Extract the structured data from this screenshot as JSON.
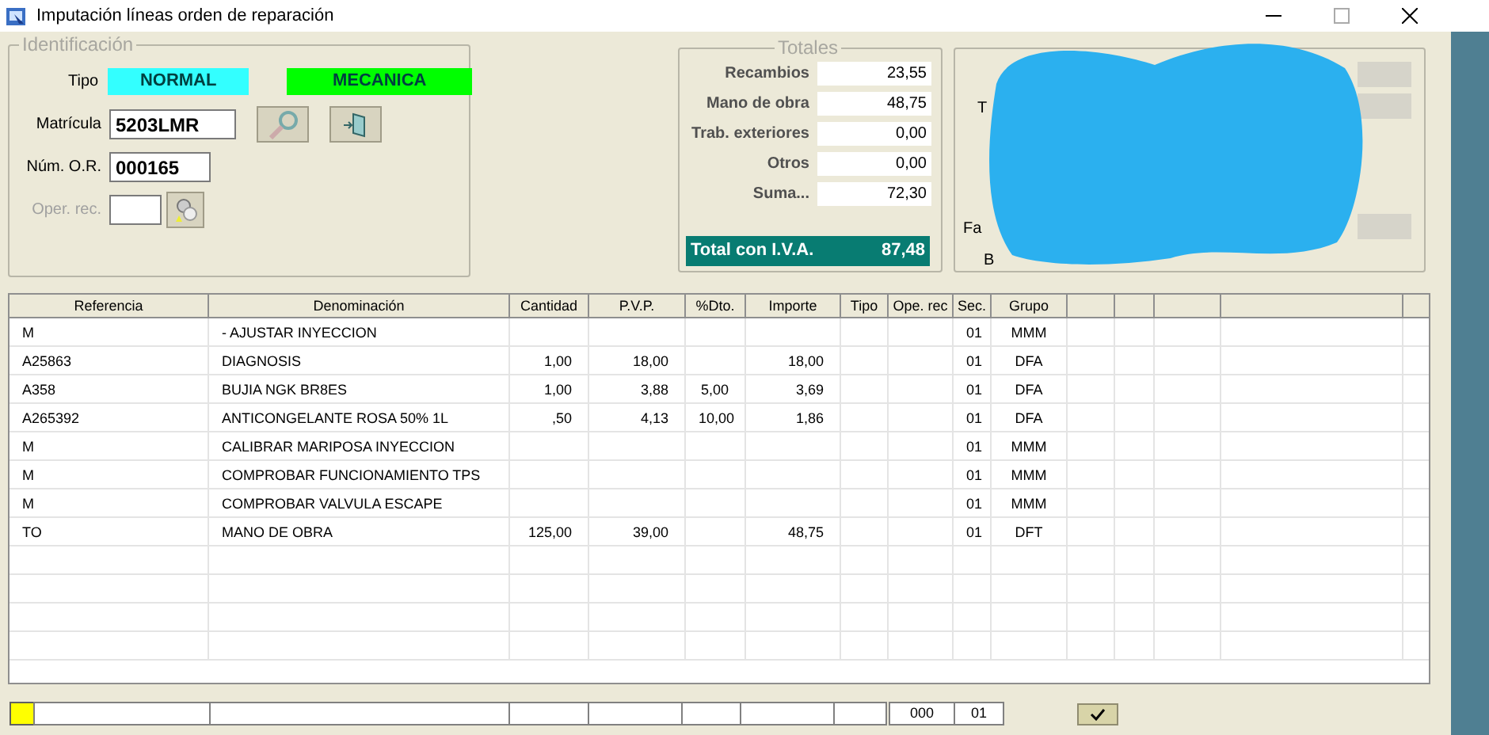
{
  "window": {
    "title": "Imputación líneas orden de reparación"
  },
  "identificacion": {
    "legend": "Identificación",
    "tipo_label": "Tipo",
    "tipo_badges": [
      {
        "text": "NORMAL",
        "color": "#33ffff"
      },
      {
        "text": "MECANICA",
        "color": "#00ff00"
      }
    ],
    "fields": [
      {
        "label": "Matrícula",
        "value": "5203LMR",
        "disabled": false
      },
      {
        "label": "Núm. O.R.",
        "value": "000165",
        "disabled": false
      },
      {
        "label": "Oper. rec.",
        "disabled": true
      }
    ]
  },
  "totales": {
    "legend": "Totales",
    "rows": [
      {
        "label": "Recambios",
        "value": "23,55"
      },
      {
        "label": "Mano de obra",
        "value": "48,75"
      },
      {
        "label": "Trab. exteriores",
        "value": "0,00"
      },
      {
        "label": "Otros",
        "value": "0,00"
      },
      {
        "label": "Suma...",
        "value": "72,30"
      }
    ],
    "total": {
      "label": "Total con I.V.A.",
      "value": "87,48"
    }
  },
  "cliente": {
    "labels": [
      "T",
      "Fa",
      "B"
    ]
  },
  "table": {
    "columns": [
      "Referencia",
      "Denominación",
      "Cantidad",
      "P.V.P.",
      "%Dto.",
      "Importe",
      "Tipo",
      "Ope. rec",
      "Sec.",
      "Grupo"
    ],
    "rows": [
      [
        "M",
        "- AJUSTAR INYECCION",
        "",
        "",
        "",
        "",
        "",
        "",
        "01",
        "MMM"
      ],
      [
        "A25863",
        "DIAGNOSIS",
        "1,00",
        "18,00",
        "",
        "18,00",
        "",
        "",
        "01",
        "DFA"
      ],
      [
        "A358",
        "BUJIA NGK BR8ES",
        "1,00",
        "3,88",
        "5,00",
        "3,69",
        "",
        "",
        "01",
        "DFA"
      ],
      [
        "A265392",
        "ANTICONGELANTE ROSA 50% 1L",
        ",50",
        "4,13",
        "10,00",
        "1,86",
        "",
        "",
        "01",
        "DFA"
      ],
      [
        "M",
        "CALIBRAR MARIPOSA INYECCION",
        "",
        "",
        "",
        "",
        "",
        "",
        "01",
        "MMM"
      ],
      [
        "M",
        "COMPROBAR FUNCIONAMIENTO TPS",
        "",
        "",
        "",
        "",
        "",
        "",
        "01",
        "MMM"
      ],
      [
        "M",
        "COMPROBAR VALVULA ESCAPE",
        "",
        "",
        "",
        "",
        "",
        "",
        "01",
        "MMM"
      ],
      [
        "TO",
        "MANO DE OBRA",
        "125,00",
        "39,00",
        "",
        "48,75",
        "",
        "",
        "01",
        "DFT"
      ]
    ]
  },
  "footer": {
    "fields": [
      "000",
      "01"
    ]
  }
}
